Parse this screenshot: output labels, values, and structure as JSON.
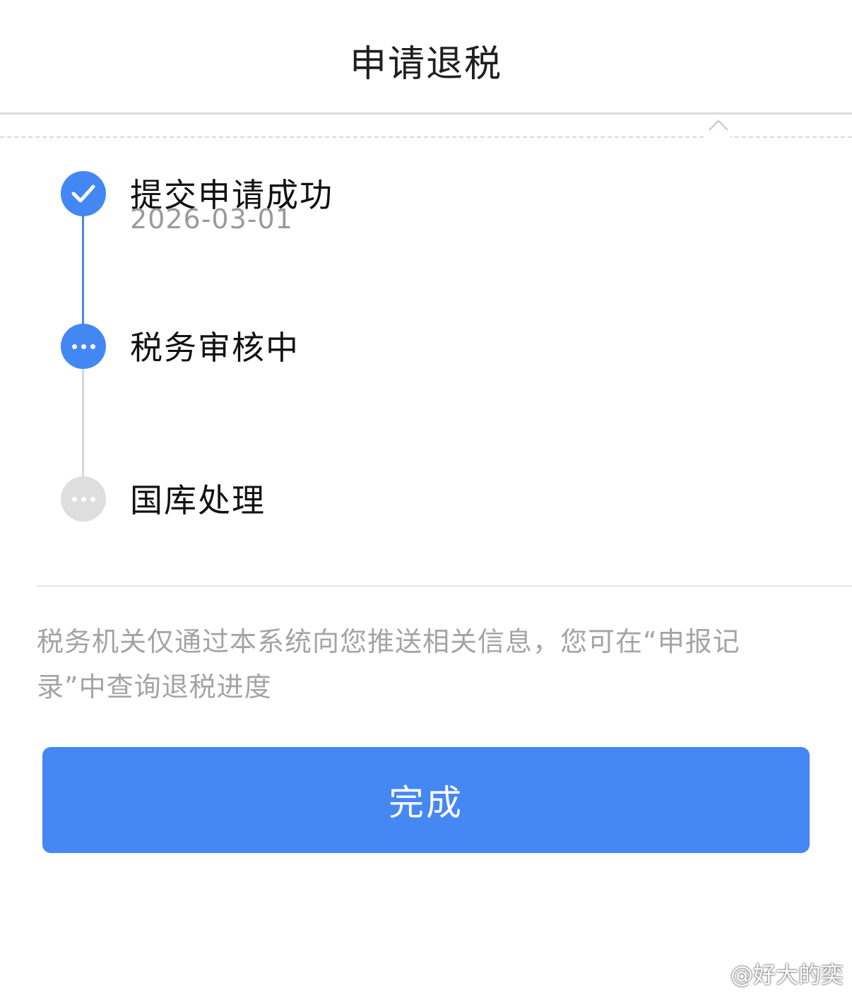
{
  "header": {
    "title": "申请退税"
  },
  "timeline": {
    "steps": [
      {
        "title": "提交申请成功",
        "date": "2026-03-01",
        "status": "done"
      },
      {
        "title": "税务审核中",
        "status": "in-progress"
      },
      {
        "title": "国库处理",
        "status": "pending"
      }
    ]
  },
  "notice": {
    "text": "税务机关仅通过本系统向您推送相关信息，您可在“申报记录”中查询退税进度"
  },
  "actions": {
    "done_label": "完成"
  },
  "watermark": {
    "text": "@好大的奕"
  },
  "colors": {
    "accent": "#4587f3",
    "pending": "#dedede",
    "muted_text": "#a4a4a4"
  },
  "icons": {
    "step1": "check-icon",
    "step2": "more-dots-icon",
    "step3": "more-dots-icon",
    "collapse": "chevron-up-icon",
    "watermark_logo": "weibo-logo-icon"
  }
}
